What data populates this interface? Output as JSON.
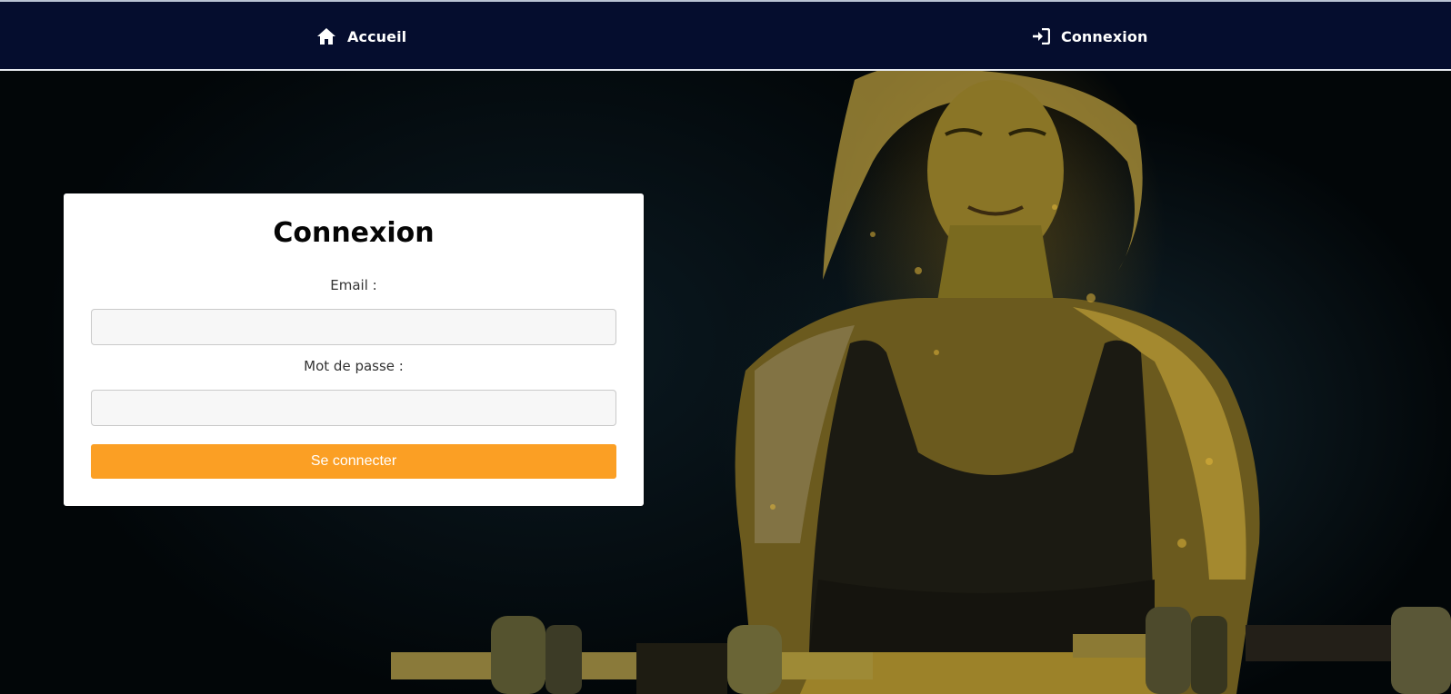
{
  "nav": {
    "home": {
      "label": "Accueil",
      "icon": "home-icon"
    },
    "login": {
      "label": "Connexion",
      "icon": "sign-in-icon"
    }
  },
  "login_form": {
    "title": "Connexion",
    "email_label": "Email :",
    "email_value": "",
    "password_label": "Mot de passe :",
    "password_value": "",
    "submit_label": "Se connecter"
  },
  "colors": {
    "nav_background": "#050d2e",
    "button_accent": "#fb9f24",
    "card_background": "#ffffff"
  },
  "hero_image": {
    "icon": "fitness-woman-dumbbells-photo"
  }
}
